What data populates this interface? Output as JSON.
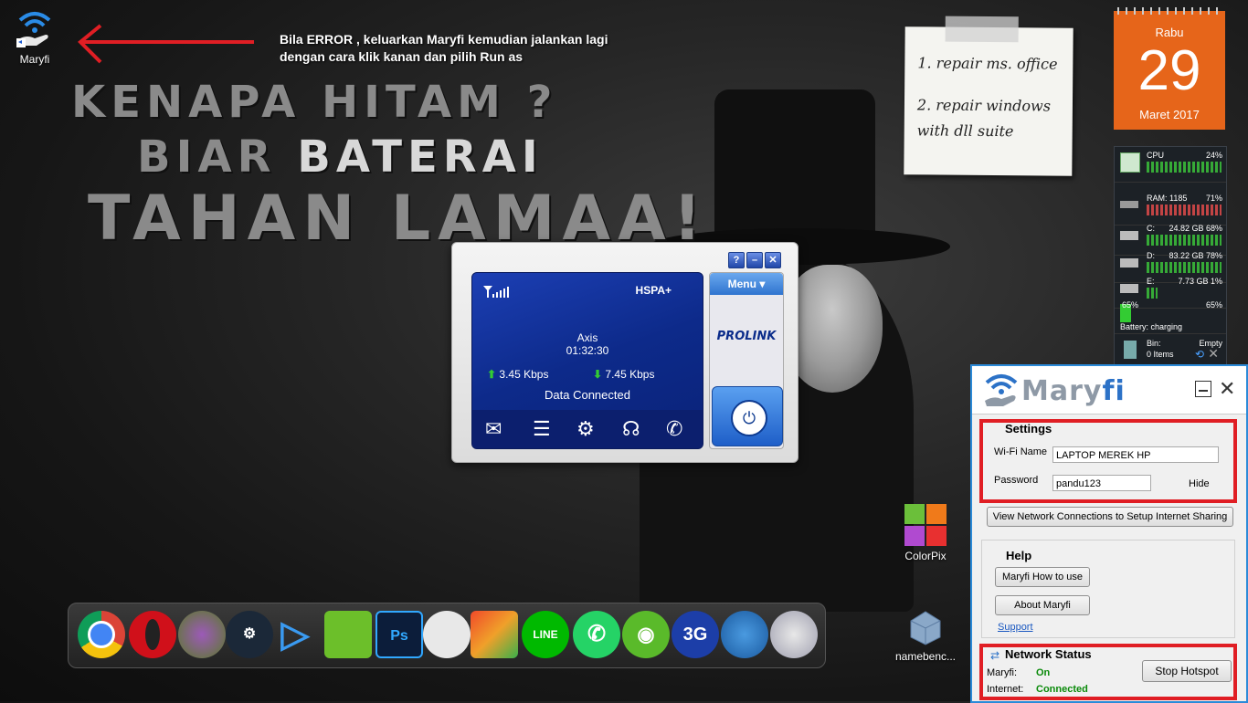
{
  "desktop": {
    "icons": [
      {
        "label": "Maryfi"
      },
      {
        "label": "ColorPix"
      },
      {
        "label": "namebenc..."
      }
    ],
    "annotation": {
      "line1": "Bila ERROR , keluarkan Maryfi kemudian jalankan lagi",
      "line2": "dengan cara klik kanan dan pilih Run as"
    },
    "wallpaper_text": {
      "line1": "KENAPA HITAM ?",
      "line2_a": "BIAR ",
      "line2_b": "BATERAI",
      "line3": "TAHAN LAMAA!"
    }
  },
  "sticky_note": {
    "item1": "1. repair ms. office",
    "item2a": "2. repair windows",
    "item2b": "with dll suite"
  },
  "calendar": {
    "day": "Rabu",
    "date": "29",
    "month": "Maret 2017"
  },
  "system_monitor": {
    "cpu": {
      "label": "CPU",
      "value": "24%"
    },
    "ram": {
      "label": "RAM: 1185",
      "value": "71%"
    },
    "drive_c": {
      "label": "C:",
      "value": "24.82 GB 68%"
    },
    "drive_d": {
      "label": "D:",
      "value": "83.22 GB 78%"
    },
    "drive_e": {
      "label": "E:",
      "value": "7.73 GB 1%"
    },
    "battery": {
      "left": "65%",
      "right": "65%",
      "status": "Battery: charging"
    },
    "bin": {
      "label": "Bin:",
      "value": "Empty",
      "items": "0 Items"
    }
  },
  "modem": {
    "network_type": "HSPA+",
    "operator": "Axis",
    "duration": "01:32:30",
    "upload": "3.45 Kbps",
    "download": "7.45 Kbps",
    "status": "Data Connected",
    "menu_label": "Menu",
    "brand": "PROLINK",
    "help_btn": "?",
    "min_btn": "–",
    "close_btn": "✕"
  },
  "dock": {
    "apps": [
      {
        "name": "chrome"
      },
      {
        "name": "opera"
      },
      {
        "name": "tor"
      },
      {
        "name": "steam"
      },
      {
        "name": "media-player"
      },
      {
        "name": "coreldraw"
      },
      {
        "name": "photoshop",
        "label": "Ps"
      },
      {
        "name": "disk-tool"
      },
      {
        "name": "avg"
      },
      {
        "name": "line",
        "label": "LINE"
      },
      {
        "name": "whatsapp"
      },
      {
        "name": "wifi-hotspot"
      },
      {
        "name": "3g-modem",
        "label": "3G"
      },
      {
        "name": "internet-download-manager"
      },
      {
        "name": "media-burner"
      }
    ]
  },
  "maryfi": {
    "title_a": "Mary",
    "title_b": "fi",
    "settings": {
      "title": "Settings",
      "wifi_name_label": "Wi-Fi Name",
      "wifi_name_value": "LAPTOP MEREK HP",
      "password_label": "Password",
      "password_value": "pandu123",
      "hide_label": "Hide"
    },
    "view_network_btn": "View Network Connections to Setup Internet Sharing",
    "help": {
      "title": "Help",
      "how_to_btn": "Maryfi How to use",
      "about_btn": "About Maryfi",
      "support_link": "Support"
    },
    "network_status": {
      "title": "Network Status",
      "maryfi_label": "Maryfi:",
      "maryfi_value": "On",
      "internet_label": "Internet:",
      "internet_value": "Connected",
      "stop_btn": "Stop Hotspot"
    }
  }
}
